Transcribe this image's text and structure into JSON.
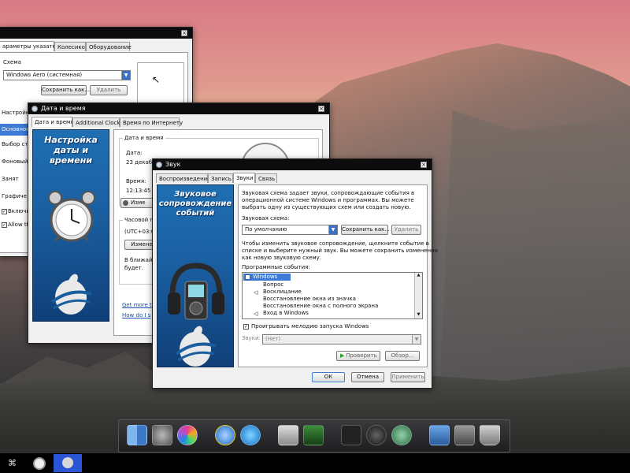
{
  "mouse_window": {
    "tabs": [
      "араметры указателя",
      "Колесико",
      "Оборудование"
    ],
    "scheme_label": "Схема",
    "scheme_value": "Windows Aero (системная)",
    "save_as": "Сохранить как...",
    "delete": "Удалить",
    "left_items": [
      "Настройки",
      "Основное",
      "Выбор стр",
      "Фоновый",
      "Занят",
      "Графиче",
      "Включи",
      "Allow th"
    ]
  },
  "datetime_window": {
    "title": "Дата и время",
    "tabs": [
      "Дата и время",
      "Additional Clocks",
      "Время по Интернету"
    ],
    "banner_title": "Настройка\nдаты и\nвремени",
    "group_label": "Дата и время",
    "date_label": "Дата:",
    "date_value": "23 декабр",
    "time_label": "Время:",
    "time_value": "12:13:45",
    "change_btn": "Изме",
    "tz_label": "Часовой п",
    "tz_value": "(UTC+03:0",
    "change_tz_btn": "Измене",
    "note_line1": "В ближайш",
    "note_line2": "будет.",
    "link1": "Get more t",
    "link2": "How do I s"
  },
  "sound_window": {
    "title": "Звук",
    "tabs": [
      "Воспроизведение",
      "Запись",
      "Звуки",
      "Связь"
    ],
    "banner_title": "Звуковое\nсопровождение\nсобытий",
    "desc": [
      "Звуковая схема задает звуки, сопровождающие события в",
      "операционной системе Windows и программах. Вы можете",
      "выбрать одну из существующих схем или создать новую."
    ],
    "scheme_label": "Звуковая схема:",
    "scheme_value": "По умолчанию",
    "save_as": "Сохранить как...",
    "delete": "Удалить",
    "hint": [
      "Чтобы изменить звуковое сопровождение, щелкните событие в",
      "списке и выберите нужный звук. Вы можете сохранить изменения",
      "как новую звуковую схему."
    ],
    "events_label": "Программные события:",
    "events": [
      "Windows",
      "Вопрос",
      "Восклицание",
      "Восстановление окна из значка",
      "Восстановление окна с полного экрана",
      "Вход в Windows"
    ],
    "play_startup": "Проигрывать мелодию запуска Windows",
    "sounds_label": "Звуки:",
    "sounds_value": "(Нет)",
    "test_btn": "Проверить",
    "browse_btn": "Обзор...",
    "ok": "ОК",
    "cancel": "Отмена",
    "apply": "Применить"
  },
  "dock": {
    "icons": [
      "finder-icon",
      "system-preferences-icon",
      "colorful-app-icon",
      "internet-explorer-icon",
      "quicktime-icon",
      "hard-drive-icon",
      "terminal-icon",
      "dashboard-icon",
      "speed-gauge-icon",
      "time-machine-icon",
      "spaces-icon",
      "share-icon",
      "trash-icon"
    ]
  },
  "taskbar": {
    "icons": [
      "menu-icon",
      "alarm-clock-icon",
      "sound-icon"
    ]
  },
  "colors": {
    "banner_blue": "#1a5ea0",
    "titlebar": "#0c0c0c",
    "accent": "#3c6fc8"
  }
}
